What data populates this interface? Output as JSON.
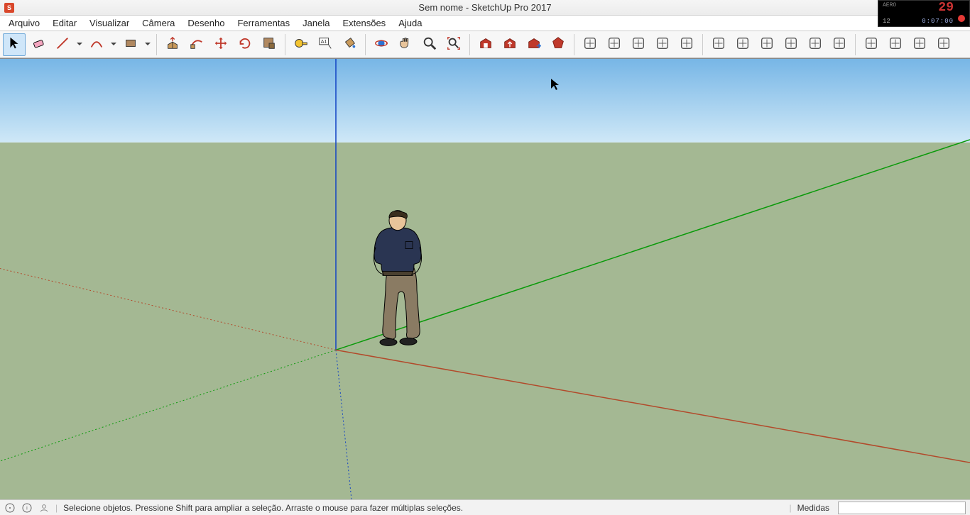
{
  "titlebar": {
    "title": "Sem nome - SketchUp Pro 2017",
    "app_badge": "S"
  },
  "overlay": {
    "label_small": "AERO",
    "big_num": "29",
    "mode": "12",
    "time": "0:07:00"
  },
  "menu": {
    "items": [
      "Arquivo",
      "Editar",
      "Visualizar",
      "Câmera",
      "Desenho",
      "Ferramentas",
      "Janela",
      "Extensões",
      "Ajuda"
    ]
  },
  "toolbar": {
    "groups": [
      {
        "kind": "btn",
        "name": "select-tool",
        "active": true
      },
      {
        "kind": "btn",
        "name": "eraser-tool"
      },
      {
        "kind": "combo",
        "name": "line-tool"
      },
      {
        "kind": "combo",
        "name": "arc-tool"
      },
      {
        "kind": "combo",
        "name": "rectangle-tool"
      },
      {
        "kind": "sep"
      },
      {
        "kind": "btn",
        "name": "pushpull-tool"
      },
      {
        "kind": "btn",
        "name": "followme-tool"
      },
      {
        "kind": "btn",
        "name": "move-tool"
      },
      {
        "kind": "btn",
        "name": "rotate-tool"
      },
      {
        "kind": "btn",
        "name": "scale-tool"
      },
      {
        "kind": "sep"
      },
      {
        "kind": "btn",
        "name": "tape-measure-tool"
      },
      {
        "kind": "btn",
        "name": "text-label-tool"
      },
      {
        "kind": "btn",
        "name": "paint-bucket-tool"
      },
      {
        "kind": "sep"
      },
      {
        "kind": "btn",
        "name": "orbit-tool"
      },
      {
        "kind": "btn",
        "name": "pan-tool"
      },
      {
        "kind": "btn",
        "name": "zoom-tool"
      },
      {
        "kind": "btn",
        "name": "zoom-extents-tool"
      },
      {
        "kind": "sep"
      },
      {
        "kind": "btn",
        "name": "warehouse-get-tool"
      },
      {
        "kind": "btn",
        "name": "warehouse-share-tool"
      },
      {
        "kind": "btn",
        "name": "extension-warehouse-tool"
      },
      {
        "kind": "btn",
        "name": "ruby-console-tool"
      },
      {
        "kind": "sep"
      },
      {
        "kind": "btn",
        "name": "sandbox-contours-tool",
        "mono": true
      },
      {
        "kind": "btn",
        "name": "sandbox-scratch-tool",
        "mono": true
      },
      {
        "kind": "btn",
        "name": "sandbox-smoove-tool",
        "mono": true
      },
      {
        "kind": "btn",
        "name": "sandbox-stamp-tool",
        "mono": true
      },
      {
        "kind": "btn",
        "name": "sandbox-drape-tool",
        "mono": true
      },
      {
        "kind": "sep"
      },
      {
        "kind": "btn",
        "name": "solid-outer-shell-tool",
        "mono": true
      },
      {
        "kind": "btn",
        "name": "solid-intersect-tool",
        "mono": true
      },
      {
        "kind": "btn",
        "name": "solid-union-tool",
        "mono": true
      },
      {
        "kind": "btn",
        "name": "solid-subtract-tool",
        "mono": true
      },
      {
        "kind": "btn",
        "name": "solid-trim-tool",
        "mono": true
      },
      {
        "kind": "btn",
        "name": "solid-split-tool",
        "mono": true
      },
      {
        "kind": "sep"
      },
      {
        "kind": "btn",
        "name": "style-xray-tool",
        "mono": true
      },
      {
        "kind": "btn",
        "name": "style-backedges-tool",
        "mono": true
      },
      {
        "kind": "btn",
        "name": "style-wire-tool",
        "mono": true
      },
      {
        "kind": "btn",
        "name": "style-hidden-tool",
        "mono": true
      }
    ]
  },
  "status": {
    "hint": "Selecione objetos. Pressione Shift para ampliar a seleção. Arraste o mouse para fazer múltiplas seleções.",
    "measurements_label": "Medidas"
  }
}
